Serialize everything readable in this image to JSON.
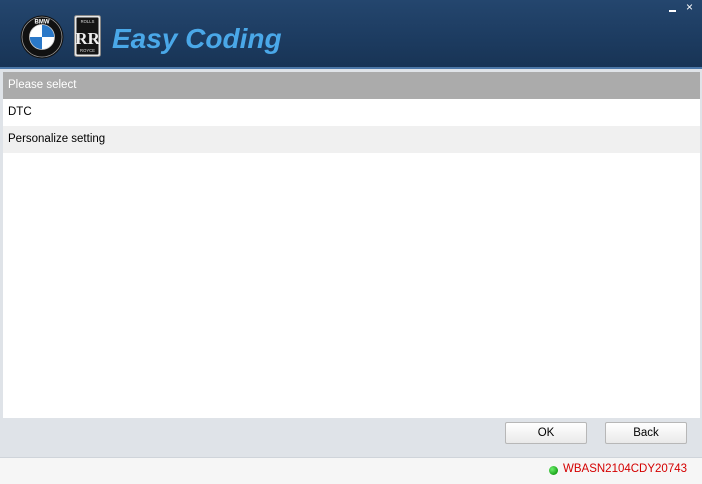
{
  "header": {
    "brand_text": "Easy Coding",
    "bmw_logo_text": "BMW",
    "rr_logo_top": "ROLLS",
    "rr_logo_bottom": "ROYCE",
    "rr_monogram": "RR",
    "minimize_symbol": "",
    "close_symbol": "×"
  },
  "list": {
    "header": "Please select",
    "items": [
      {
        "label": "DTC"
      },
      {
        "label": "Personalize setting"
      }
    ]
  },
  "buttons": {
    "ok_label": "OK",
    "back_label": "Back"
  },
  "status": {
    "vin": "WBASN2104CDY20743",
    "indicator_color": "#1aa31a",
    "vin_color": "#d40000"
  },
  "colors": {
    "header_bg": "#1d3c61",
    "brand_blue": "#4aa8e8",
    "list_header_bg": "#ababab"
  }
}
